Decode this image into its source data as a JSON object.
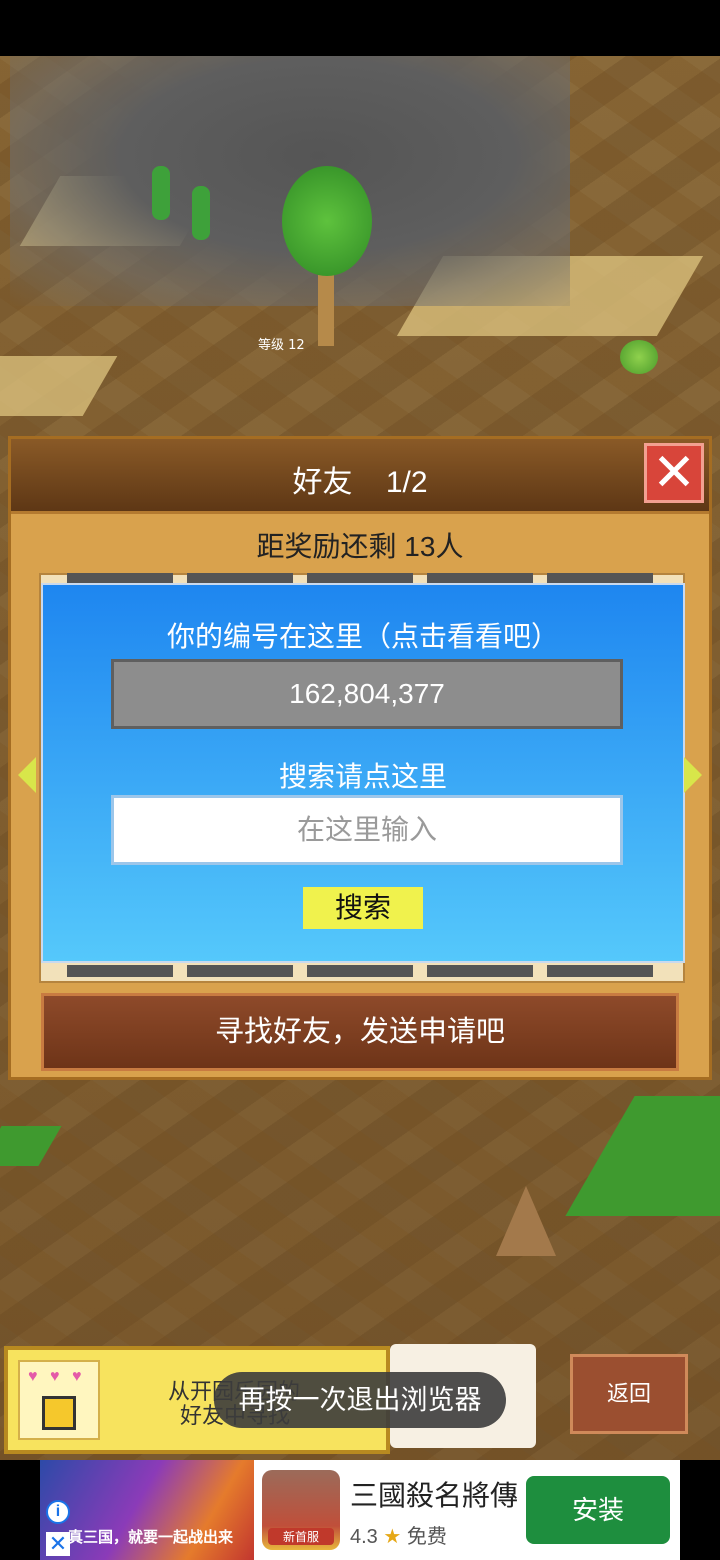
{
  "game": {
    "level_label": "等级",
    "level_value": "12"
  },
  "dialog": {
    "title": "好友",
    "page": "1/2",
    "close_icon": "close-x",
    "reward_text": "距奖励还剩 13人",
    "id_label": "你的编号在这里（点击看看吧）",
    "id_value": "162,804,377",
    "search_label": "搜索请点这里",
    "search_placeholder": "在这里输入",
    "search_button": "搜索",
    "find_friends": "寻找好友，发送申请吧"
  },
  "bottom": {
    "notice_line1": "从开园乐园的",
    "notice_line2": "好友中寻找",
    "back_button": "返回",
    "toast": "再按一次退出浏览器"
  },
  "ad": {
    "banner_text": "真三国，就要一起战出来",
    "icon_badge": "新首服",
    "title": "三國殺名將傳",
    "rating": "4.3",
    "price": "免费",
    "install": "安装",
    "colors": {
      "install": "#1e8e3e",
      "info": "#1a73e8"
    }
  }
}
